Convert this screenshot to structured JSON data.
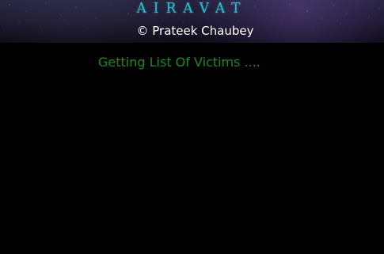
{
  "header": {
    "logo_text": "AIRAVAT",
    "copyright": "© Prateek Chaubey"
  },
  "main": {
    "status_text": "Getting List Of Victims ...."
  },
  "colors": {
    "background": "#000000",
    "logo": "#2fb9c9",
    "copyright": "#ffffff",
    "status": "#1f8a1f"
  }
}
